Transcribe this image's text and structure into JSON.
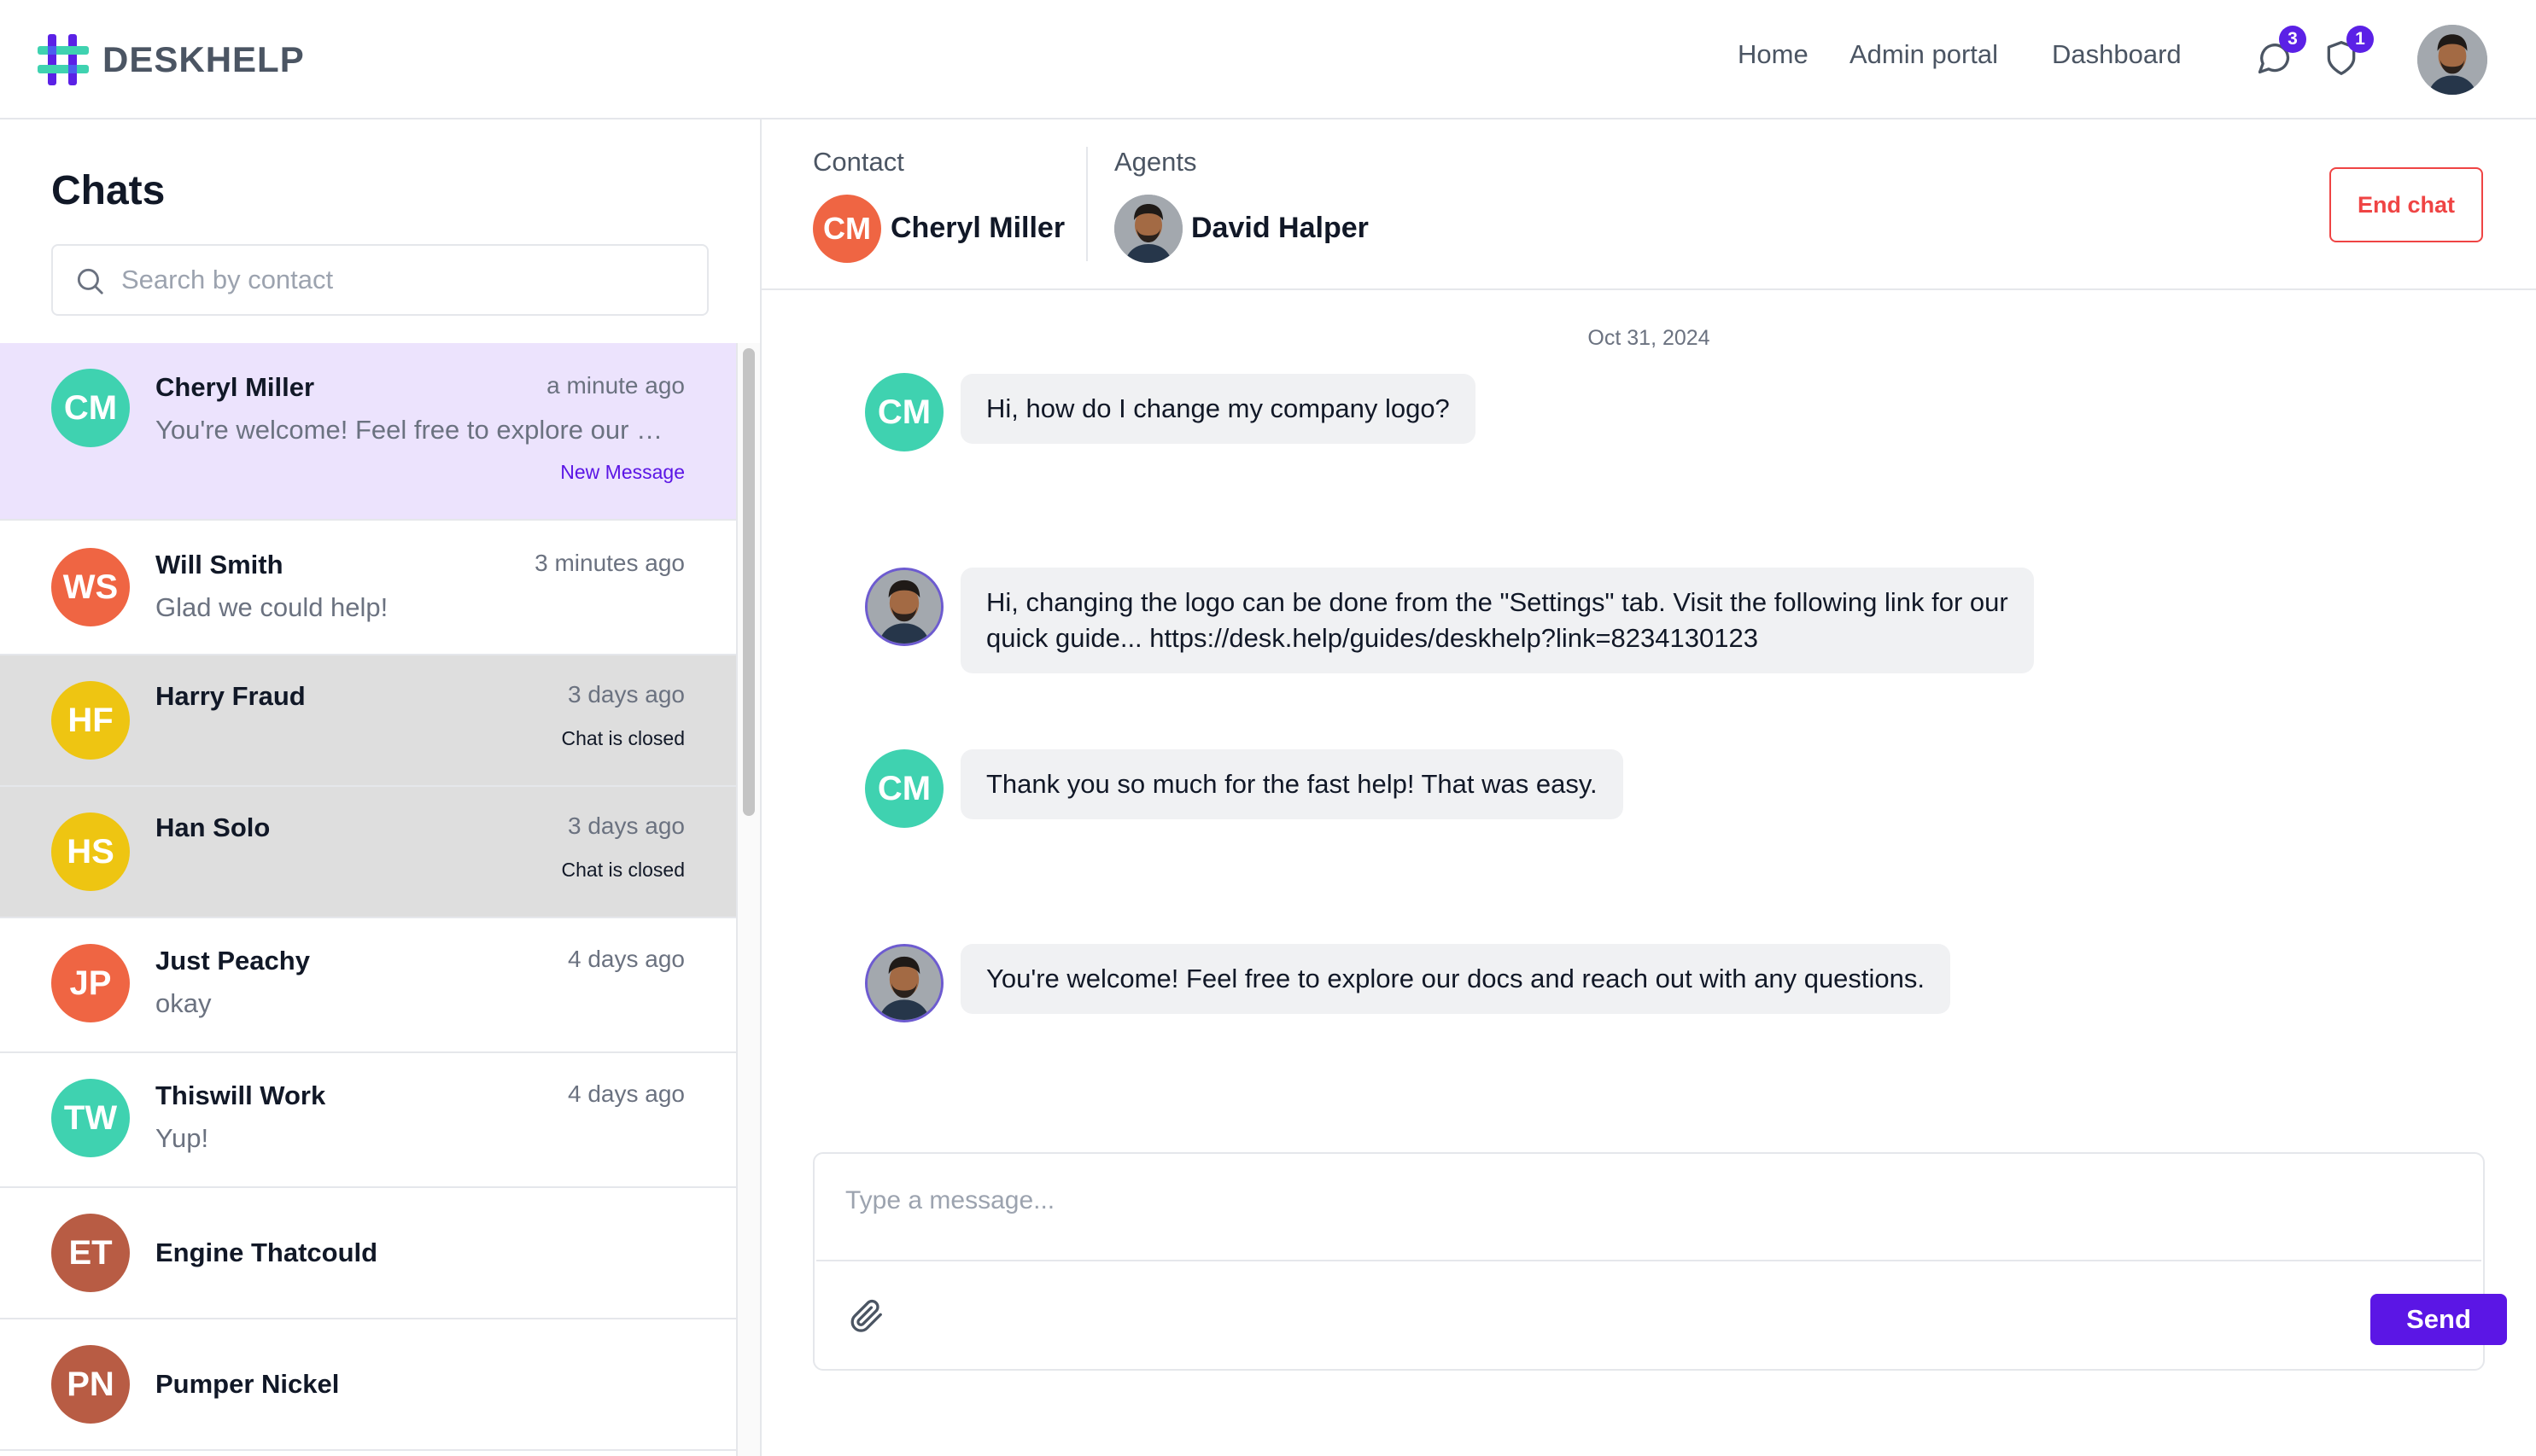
{
  "app": {
    "name": "DESKHELP"
  },
  "nav": {
    "links": [
      "Home",
      "Admin portal",
      "Dashboard"
    ],
    "messages_badge": "3",
    "alerts_badge": "1"
  },
  "sidebar": {
    "title": "Chats",
    "search_placeholder": "Search by contact",
    "chats": [
      {
        "initials": "CM",
        "name": "Cheryl Miller",
        "time": "a minute ago",
        "preview": "You're welcome! Feel free to explore our docs and reach out with any questions.",
        "tag": "New Message",
        "color": "#3fd2b0"
      },
      {
        "initials": "WS",
        "name": "Will Smith",
        "time": "3 minutes ago",
        "preview": "Glad we could help!",
        "tag": "",
        "color": "#ef6543"
      },
      {
        "initials": "HF",
        "name": "Harry Fraud",
        "time": "3 days ago",
        "preview": "",
        "tag": "Chat is closed",
        "color": "#eec512"
      },
      {
        "initials": "HS",
        "name": "Han Solo",
        "time": "3 days ago",
        "preview": "",
        "tag": "Chat is closed",
        "color": "#eec512"
      },
      {
        "initials": "JP",
        "name": "Just Peachy",
        "time": "4 days ago",
        "preview": "okay",
        "tag": "",
        "color": "#ef6543"
      },
      {
        "initials": "TW",
        "name": "Thiswill Work",
        "time": "4 days ago",
        "preview": "Yup!",
        "tag": "",
        "color": "#3fd2b0"
      },
      {
        "initials": "ET",
        "name": "Engine Thatcould",
        "time": "",
        "preview": "",
        "tag": "",
        "color": "#b85c44"
      },
      {
        "initials": "PN",
        "name": "Pumper Nickel",
        "time": "",
        "preview": "",
        "tag": "",
        "color": "#b85c44"
      }
    ]
  },
  "conversation": {
    "contact_label": "Contact",
    "contact_initials": "CM",
    "contact_name": "Cheryl Miller",
    "contact_color": "#ef6543",
    "agents_label": "Agents",
    "agent_name": "David Halper",
    "end_chat_label": "End chat",
    "date": "Oct 31, 2024",
    "messages": [
      {
        "sender": "contact",
        "initials": "CM",
        "lines": [
          "Hi, how do I change my company logo?"
        ]
      },
      {
        "sender": "agent",
        "lines": [
          "Hi, changing the logo can be done from the \"Settings\" tab. Visit the following link for our",
          "quick guide... https://desk.help/guides/deskhelp?link=8234130123"
        ]
      },
      {
        "sender": "contact",
        "initials": "CM",
        "lines": [
          "Thank you so much for the fast help! That was easy."
        ]
      },
      {
        "sender": "agent",
        "lines": [
          "You're welcome! Feel free to explore our docs and reach out with any questions."
        ]
      }
    ],
    "composer_placeholder": "Type a message...",
    "send_label": "Send"
  },
  "colors": {
    "accent": "#5b16e5",
    "danger": "#ef4444",
    "selected_row": "#ece3fd",
    "closed_row": "#dedede"
  }
}
